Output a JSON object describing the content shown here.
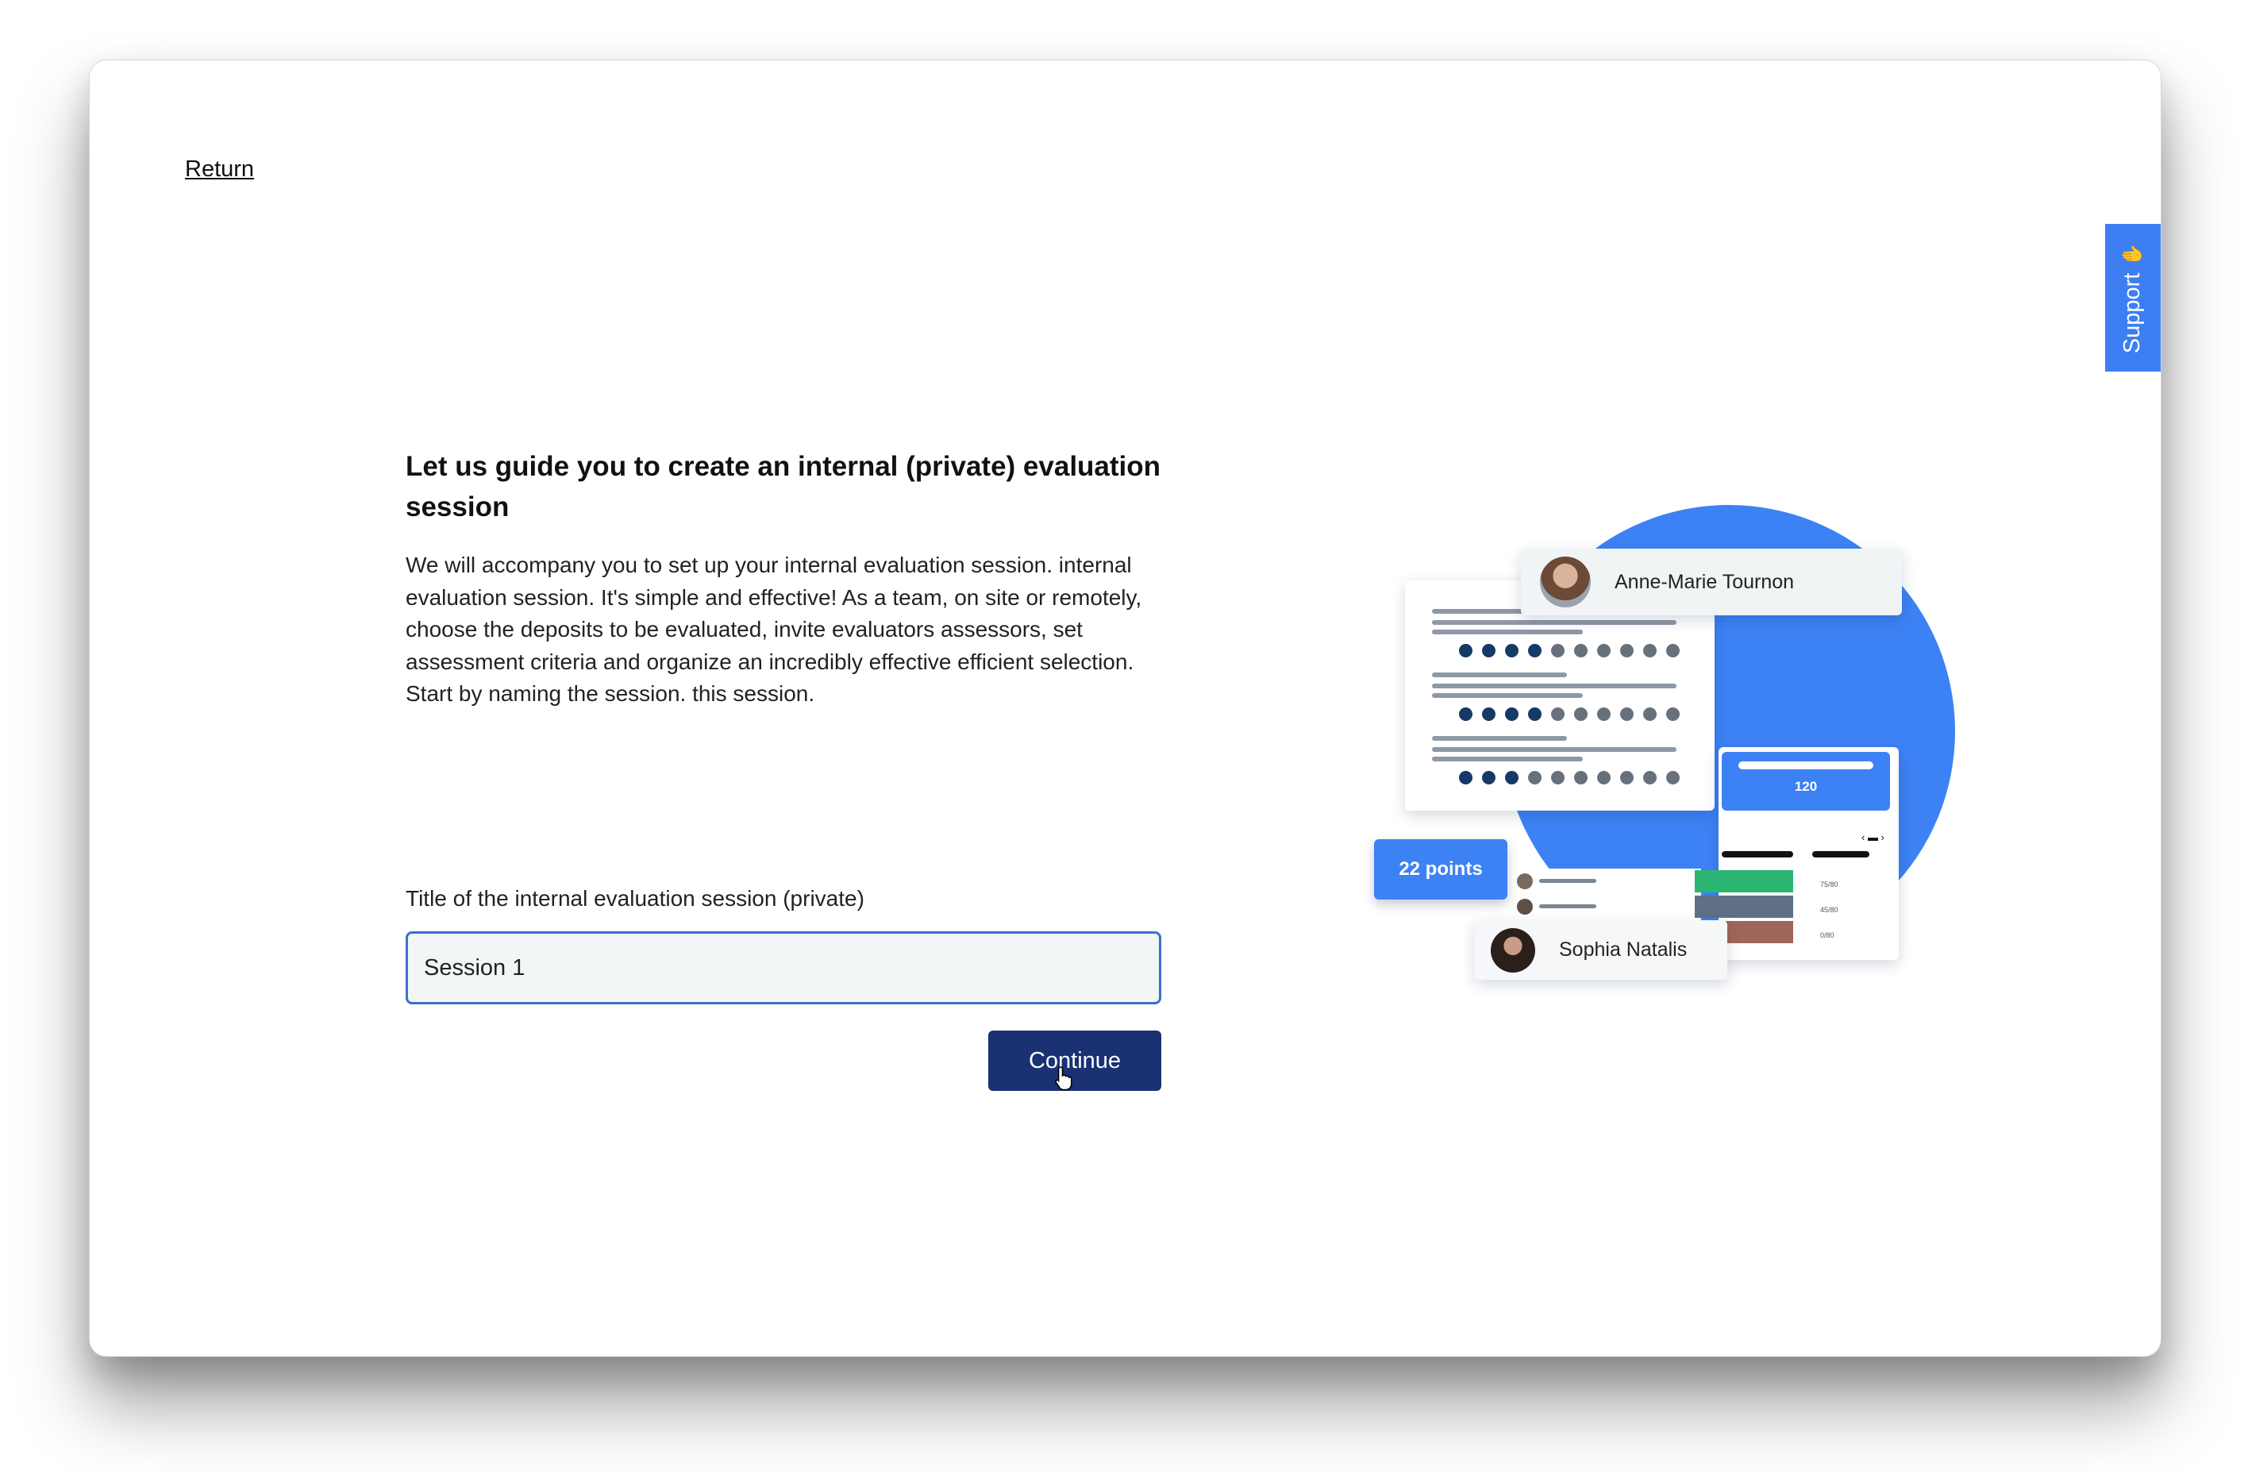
{
  "nav": {
    "return_label": "Return"
  },
  "support": {
    "label": "Support",
    "icon": "hand-icon"
  },
  "main": {
    "title": "Let us guide you to create an internal (private) evaluation session",
    "description": "We will accompany you to set up your internal evaluation session. internal evaluation session. It's simple and effective! As a team, on site or remotely, choose the deposits to be evaluated, invite evaluators assessors, set assessment criteria and organize an incredibly effective efficient selection. Start by naming the session. this session.",
    "field_label": "Title of the internal evaluation session (private)",
    "field_value": "Session 1",
    "continue_label": "Continue"
  },
  "illustration": {
    "person_top": "Anne-Marie Tournon",
    "person_bottom": "Sophia Natalis",
    "points_label": "22 points",
    "score_value": "120",
    "table_values": [
      "75/80",
      "45/80",
      "0/80"
    ],
    "ratings": [
      4,
      4,
      3
    ]
  },
  "colors": {
    "accent": "#3d82f4",
    "button": "#1a3174",
    "input_border": "#3d6fd0",
    "input_bg": "#f3f6f6",
    "green": "#2bb673",
    "slate": "#5f6f85",
    "red": "#a1665a"
  }
}
